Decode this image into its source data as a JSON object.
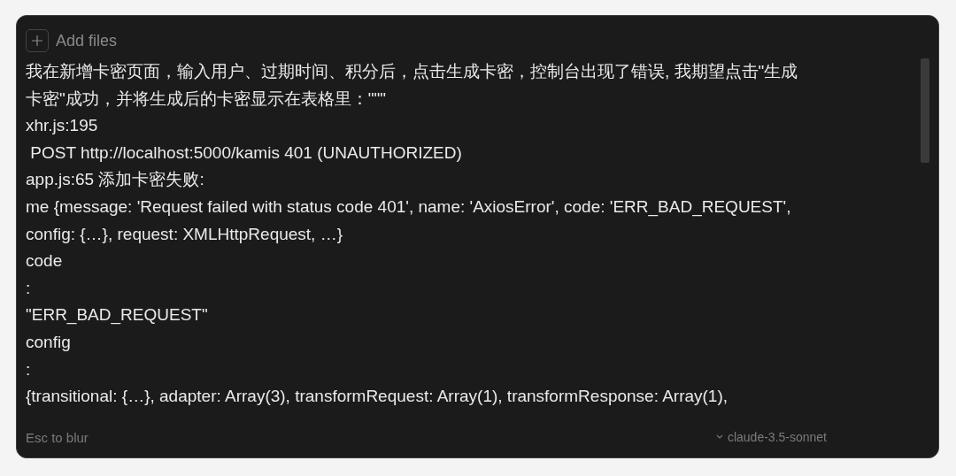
{
  "attach": {
    "label": "Add files"
  },
  "prompt_lines": [
    "我在新增卡密页面，输入用户、过期时间、积分后，点击生成卡密，控制台出现了错误, 我期望点击\"生成",
    "卡密\"成功，并将生成后的卡密显示在表格里：\"\"\"",
    "xhr.js:195",
    " POST http://localhost:5000/kamis 401 (UNAUTHORIZED)",
    "app.js:65 添加卡密失败:",
    "me {message: 'Request failed with status code 401', name: 'AxiosError', code: 'ERR_BAD_REQUEST',",
    "config: {…}, request: XMLHttpRequest, …}",
    "code",
    ":",
    "\"ERR_BAD_REQUEST\"",
    "config",
    ":",
    "{transitional: {…}, adapter: Array(3), transformRequest: Array(1), transformResponse: Array(1),"
  ],
  "hint": "Esc to blur",
  "model": "claude-3.5-sonnet"
}
